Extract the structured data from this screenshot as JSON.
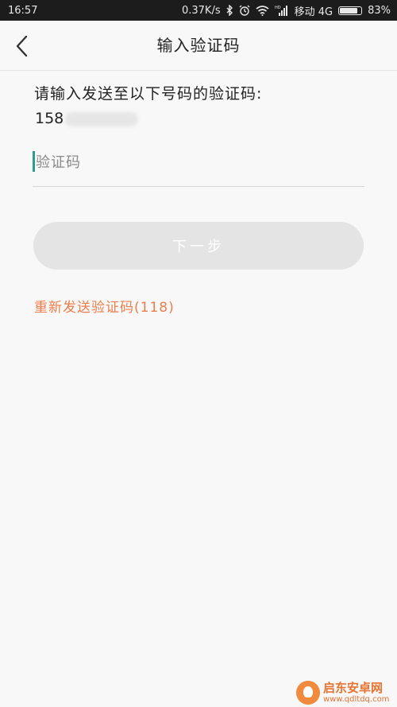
{
  "status_bar": {
    "time": "16:57",
    "speed": "0.37K/s",
    "carrier": "移动 4G",
    "hd": "HD",
    "battery_percent": "83%",
    "battery_level": 0.83
  },
  "header": {
    "title": "输入验证码",
    "back_icon": "chevron-left-icon"
  },
  "form": {
    "prompt": "请输入发送至以下号码的验证码:",
    "phone_visible": "158",
    "code_placeholder": "验证码",
    "code_value": "",
    "next_label": "下一步",
    "resend_label": "重新发送验证码(118)"
  },
  "watermark": {
    "name": "启东安卓网",
    "url": "www.qdltdq.com"
  },
  "colors": {
    "accent_orange": "#ee7d4a",
    "caret_teal": "#2a9d8f",
    "button_disabled": "#e4e4e4"
  }
}
